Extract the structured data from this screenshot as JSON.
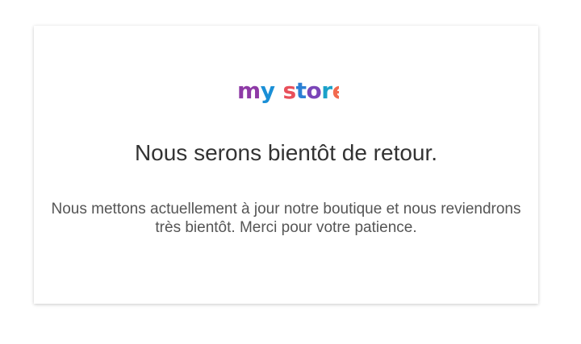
{
  "logo": {
    "text": "my store",
    "colors": {
      "m": "#8e3aa6",
      "y": "#1a8fd6",
      "s": "#e8505b",
      "t": "#2b7fd4",
      "o": "#7a45b8",
      "r": "#1aa1c9",
      "e": "#f26a4f"
    }
  },
  "maintenance": {
    "title": "Nous serons bientôt de retour.",
    "message": "Nous mettons actuellement à jour notre boutique et nous reviendrons très bientôt. Merci pour votre patience."
  },
  "colors": {
    "background": "#ffffff",
    "card": "#ffffff",
    "title_text": "#333333",
    "message_text": "#555555"
  }
}
